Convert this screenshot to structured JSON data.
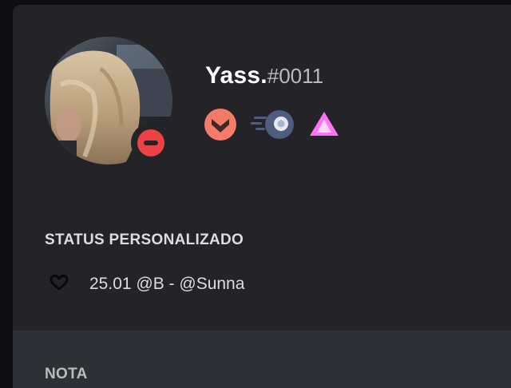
{
  "profile": {
    "username": "Yass.",
    "discriminator": "#0011",
    "presence": "dnd",
    "presence_color": "#ed4245",
    "badges": [
      {
        "name": "hypesquad-brilliance",
        "icon": "hypesquad-badge-icon",
        "color": "#f47b67"
      },
      {
        "name": "nitro",
        "icon": "nitro-badge-icon",
        "color": "#4f5d7e"
      },
      {
        "name": "server-boost",
        "icon": "boost-badge-icon",
        "color": "#ff73fa"
      }
    ]
  },
  "custom_status": {
    "title": "STATUS PERSONALIZADO",
    "emoji": "heart-outline-icon",
    "text": "25.01 @B - @Sunna"
  },
  "note": {
    "title": "NOTA"
  }
}
